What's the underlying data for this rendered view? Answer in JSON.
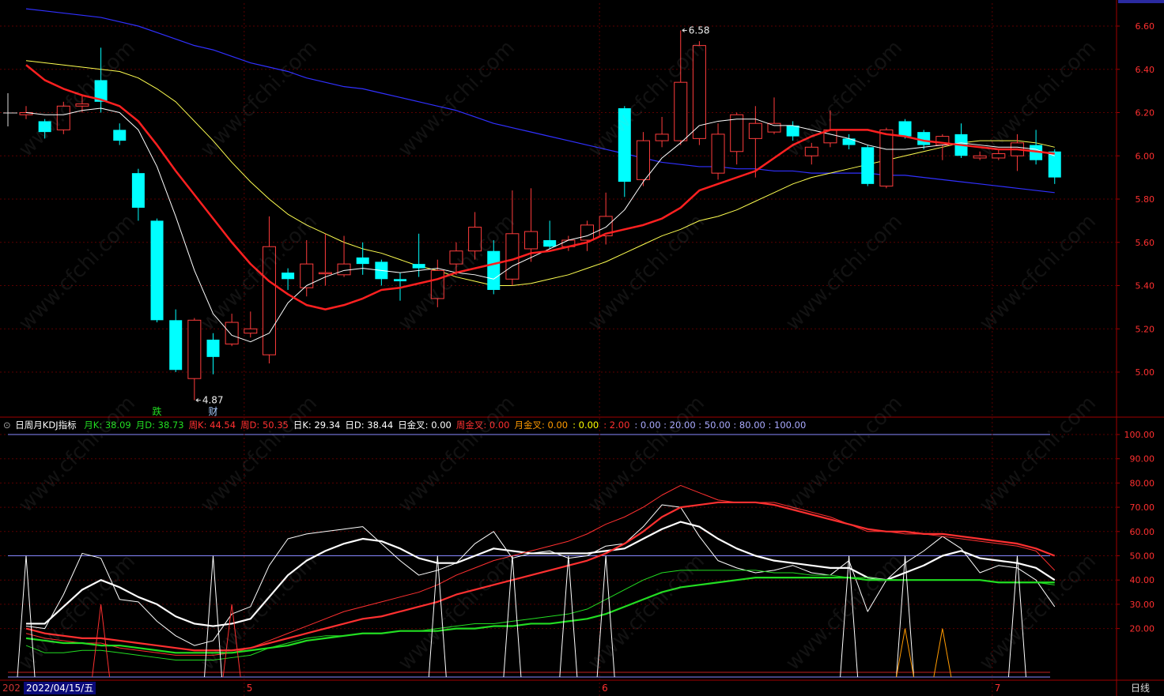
{
  "header": {
    "indicator_name": "日周月KDJ指标",
    "items": [
      {
        "text": "月K: 38.09",
        "color": "#22dd22"
      },
      {
        "text": "月D: 38.73",
        "color": "#22dd22"
      },
      {
        "text": "周K: 44.54",
        "color": "#ff3030"
      },
      {
        "text": "周D: 50.35",
        "color": "#ff3030"
      },
      {
        "text": "日K: 29.34",
        "color": "#ffffff"
      },
      {
        "text": "日D: 38.44",
        "color": "#ffffff"
      },
      {
        "text": "日金叉: 0.00",
        "color": "#ffffff"
      },
      {
        "text": "周金叉: 0.00",
        "color": "#ff3030"
      },
      {
        "text": "月金叉: 0.00",
        "color": "#ff9a00"
      },
      {
        "text": ": 0.00",
        "color": "#ffff00"
      },
      {
        "text": ": 2.00",
        "color": "#ff3030"
      },
      {
        "text": ": 0.00 : 20.00 : 50.00 : 80.00 : 100.00",
        "color": "#aaaaff"
      }
    ]
  },
  "status": {
    "date_prefix": "202",
    "date": "2022/04/15/五",
    "period_tab": "日线"
  },
  "watermark": "www.cfchi.com",
  "colors": {
    "up": "#ff3c3c",
    "down": "#00ffff",
    "ma_fast": "#ffffff",
    "ma_red": "#ff2020",
    "ma_yellow": "#ffff50",
    "ma_blue": "#3030ff",
    "grid": "#5a0000"
  },
  "chart_data": [
    {
      "type": "candlestick",
      "title": "",
      "y_ticks": [
        5.0,
        5.2,
        5.4,
        5.6,
        5.8,
        6.0,
        6.2,
        6.4,
        6.6
      ],
      "ylim": [
        4.8,
        6.7
      ],
      "x_labels": [
        "5",
        "6",
        "7"
      ],
      "x_label_index": [
        12,
        31,
        52
      ],
      "annotations": [
        {
          "text": "4.87",
          "index": 9,
          "value": 4.87
        },
        {
          "text": "6.58",
          "index": 35,
          "value": 6.58
        },
        {
          "text": "跌",
          "index": 7,
          "color": "#22dd22"
        },
        {
          "text": "财",
          "index": 10,
          "color": "#aaccff"
        }
      ],
      "candles": [
        [
          6.19,
          6.2,
          6.23,
          6.17
        ],
        [
          6.16,
          6.11,
          6.17,
          6.08
        ],
        [
          6.12,
          6.23,
          6.25,
          6.1
        ],
        [
          6.23,
          6.24,
          6.28,
          6.2
        ],
        [
          6.35,
          6.25,
          6.5,
          6.2
        ],
        [
          6.12,
          6.07,
          6.15,
          6.05
        ],
        [
          5.92,
          5.76,
          5.94,
          5.7
        ],
        [
          5.7,
          5.24,
          5.71,
          5.23
        ],
        [
          5.24,
          5.01,
          5.29,
          5.0
        ],
        [
          4.97,
          5.24,
          5.25,
          4.87
        ],
        [
          5.15,
          5.07,
          5.18,
          4.99
        ],
        [
          5.13,
          5.23,
          5.27,
          5.12
        ],
        [
          5.18,
          5.2,
          5.28,
          5.16
        ],
        [
          5.08,
          5.58,
          5.72,
          5.04
        ],
        [
          5.46,
          5.43,
          5.48,
          5.38
        ],
        [
          5.39,
          5.5,
          5.61,
          5.35
        ],
        [
          5.46,
          5.46,
          5.64,
          5.4
        ],
        [
          5.45,
          5.5,
          5.63,
          5.44
        ],
        [
          5.53,
          5.5,
          5.6,
          5.45
        ],
        [
          5.51,
          5.43,
          5.52,
          5.4
        ],
        [
          5.43,
          5.42,
          5.46,
          5.33
        ],
        [
          5.5,
          5.48,
          5.64,
          5.44
        ],
        [
          5.34,
          5.47,
          5.52,
          5.3
        ],
        [
          5.5,
          5.56,
          5.6,
          5.45
        ],
        [
          5.56,
          5.67,
          5.74,
          5.52
        ],
        [
          5.56,
          5.38,
          5.61,
          5.36
        ],
        [
          5.43,
          5.64,
          5.84,
          5.4
        ],
        [
          5.57,
          5.65,
          5.85,
          5.51
        ],
        [
          5.61,
          5.58,
          5.7,
          5.57
        ],
        [
          5.58,
          5.61,
          5.63,
          5.56
        ],
        [
          5.61,
          5.68,
          5.7,
          5.56
        ],
        [
          5.63,
          5.72,
          5.83,
          5.59
        ],
        [
          6.22,
          5.88,
          6.23,
          5.81
        ],
        [
          5.89,
          6.07,
          6.11,
          5.86
        ],
        [
          6.07,
          6.1,
          6.18,
          6.04
        ],
        [
          6.07,
          6.34,
          6.58,
          6.05
        ],
        [
          6.08,
          6.51,
          6.53,
          6.05
        ],
        [
          5.92,
          6.1,
          6.15,
          5.89
        ],
        [
          6.02,
          6.19,
          6.2,
          5.96
        ],
        [
          6.08,
          6.15,
          6.23,
          5.9
        ],
        [
          6.11,
          6.15,
          6.27,
          6.1
        ],
        [
          6.14,
          6.09,
          6.16,
          6.07
        ],
        [
          6.0,
          6.04,
          6.06,
          5.96
        ],
        [
          6.06,
          6.12,
          6.21,
          6.04
        ],
        [
          6.08,
          6.05,
          6.1,
          6.03
        ],
        [
          6.04,
          5.87,
          6.05,
          5.86
        ],
        [
          5.86,
          6.12,
          6.13,
          5.85
        ],
        [
          6.16,
          6.09,
          6.17,
          6.08
        ],
        [
          6.11,
          6.05,
          6.12,
          6.03
        ],
        [
          6.05,
          6.09,
          6.1,
          5.98
        ],
        [
          6.1,
          6.0,
          6.15,
          5.99
        ],
        [
          5.99,
          6.0,
          6.02,
          5.98
        ],
        [
          5.99,
          6.01,
          6.03,
          5.98
        ],
        [
          6.0,
          6.06,
          6.1,
          5.93
        ],
        [
          6.05,
          5.98,
          6.12,
          5.96
        ],
        [
          6.02,
          5.9,
          6.03,
          5.87
        ]
      ],
      "ma_white": [
        6.2,
        6.19,
        6.19,
        6.21,
        6.22,
        6.2,
        6.12,
        5.95,
        5.72,
        5.47,
        5.27,
        5.17,
        5.14,
        5.18,
        5.32,
        5.4,
        5.44,
        5.47,
        5.48,
        5.47,
        5.46,
        5.47,
        5.48,
        5.46,
        5.45,
        5.43,
        5.49,
        5.53,
        5.57,
        5.61,
        5.63,
        5.67,
        5.75,
        5.88,
        5.99,
        6.06,
        6.14,
        6.16,
        6.17,
        6.17,
        6.14,
        6.14,
        6.12,
        6.1,
        6.08,
        6.05,
        6.03,
        6.03,
        6.04,
        6.05,
        6.06,
        6.05,
        6.04,
        6.04,
        6.03,
        6.0
      ],
      "ma_red": [
        6.42,
        6.35,
        6.31,
        6.28,
        6.26,
        6.23,
        6.16,
        6.05,
        5.93,
        5.82,
        5.71,
        5.6,
        5.5,
        5.42,
        5.36,
        5.31,
        5.29,
        5.31,
        5.34,
        5.38,
        5.39,
        5.41,
        5.43,
        5.46,
        5.48,
        5.5,
        5.52,
        5.55,
        5.56,
        5.58,
        5.6,
        5.64,
        5.66,
        5.68,
        5.71,
        5.76,
        5.84,
        5.87,
        5.9,
        5.93,
        5.99,
        6.05,
        6.09,
        6.12,
        6.12,
        6.12,
        6.1,
        6.09,
        6.07,
        6.06,
        6.05,
        6.04,
        6.03,
        6.03,
        6.02,
        6.01
      ],
      "ma_yellow": [
        6.44,
        6.43,
        6.42,
        6.41,
        6.4,
        6.39,
        6.36,
        6.31,
        6.25,
        6.16,
        6.07,
        5.97,
        5.88,
        5.8,
        5.73,
        5.68,
        5.64,
        5.6,
        5.57,
        5.55,
        5.52,
        5.49,
        5.47,
        5.44,
        5.42,
        5.4,
        5.4,
        5.41,
        5.43,
        5.45,
        5.48,
        5.51,
        5.55,
        5.59,
        5.63,
        5.66,
        5.7,
        5.72,
        5.75,
        5.79,
        5.83,
        5.87,
        5.9,
        5.92,
        5.94,
        5.96,
        5.98,
        6.0,
        6.02,
        6.04,
        6.06,
        6.07,
        6.07,
        6.07,
        6.06,
        6.04
      ],
      "ma_blue": [
        6.68,
        6.67,
        6.66,
        6.65,
        6.64,
        6.62,
        6.6,
        6.57,
        6.54,
        6.51,
        6.49,
        6.46,
        6.43,
        6.41,
        6.39,
        6.36,
        6.34,
        6.32,
        6.31,
        6.29,
        6.27,
        6.25,
        6.23,
        6.21,
        6.18,
        6.15,
        6.13,
        6.11,
        6.09,
        6.07,
        6.05,
        6.03,
        6.01,
        5.99,
        5.97,
        5.96,
        5.95,
        5.95,
        5.94,
        5.94,
        5.93,
        5.93,
        5.92,
        5.92,
        5.92,
        5.92,
        5.91,
        5.91,
        5.9,
        5.89,
        5.88,
        5.87,
        5.86,
        5.85,
        5.84,
        5.83
      ]
    },
    {
      "type": "line",
      "title": "日周月KDJ指标",
      "y_ticks": [
        20,
        30,
        40,
        50,
        60,
        70,
        80,
        90,
        100
      ],
      "ylim": [
        0,
        105
      ],
      "reference_lines": [
        0,
        50,
        100
      ],
      "series": [
        {
          "name": "日K",
          "color": "#ffffff",
          "width": 1,
          "values": [
            21,
            20,
            34,
            51,
            49,
            32,
            31,
            23,
            17,
            13,
            15,
            26,
            29,
            46,
            57,
            59,
            60,
            61,
            62,
            55,
            48,
            42,
            44,
            47,
            55,
            60,
            49,
            51,
            52,
            49,
            50,
            54,
            55,
            62,
            71,
            70,
            58,
            48,
            45,
            43,
            44,
            46,
            43,
            42,
            48,
            27,
            40,
            47,
            52,
            58,
            53,
            43,
            46,
            45,
            40,
            29
          ]
        },
        {
          "name": "日D",
          "color": "#ffffff",
          "width": 2.2,
          "values": [
            22,
            22,
            29,
            36,
            40,
            37,
            33,
            30,
            25,
            22,
            21,
            22,
            24,
            33,
            42,
            48,
            52,
            55,
            57,
            56,
            53,
            49,
            47,
            47,
            50,
            53,
            52,
            51,
            51,
            51,
            51,
            52,
            53,
            57,
            61,
            64,
            62,
            57,
            53,
            50,
            48,
            47,
            46,
            45,
            45,
            41,
            40,
            43,
            46,
            50,
            52,
            49,
            48,
            47,
            45,
            40
          ]
        },
        {
          "name": "周K",
          "color": "#ff3030",
          "width": 1,
          "values": [
            18,
            16,
            15,
            14,
            14,
            12,
            11,
            10,
            9,
            9,
            9,
            10,
            12,
            15,
            18,
            21,
            24,
            27,
            29,
            31,
            33,
            35,
            38,
            42,
            45,
            48,
            50,
            52,
            54,
            56,
            59,
            63,
            66,
            70,
            75,
            79,
            76,
            73,
            72,
            72,
            72,
            70,
            68,
            66,
            63,
            60,
            60,
            59,
            59,
            58,
            57,
            56,
            55,
            54,
            52,
            44
          ]
        },
        {
          "name": "周D",
          "color": "#ff3030",
          "width": 2.2,
          "values": [
            20,
            18,
            17,
            16,
            16,
            15,
            14,
            13,
            12,
            11,
            11,
            11,
            12,
            14,
            16,
            18,
            20,
            22,
            24,
            25,
            27,
            29,
            31,
            34,
            36,
            38,
            40,
            42,
            44,
            46,
            48,
            51,
            55,
            60,
            66,
            70,
            71,
            72,
            72,
            72,
            71,
            69,
            67,
            65,
            63,
            61,
            60,
            60,
            59,
            59,
            58,
            57,
            56,
            55,
            53,
            50
          ]
        },
        {
          "name": "月K",
          "color": "#22dd22",
          "width": 1,
          "values": [
            13,
            10,
            10,
            11,
            11,
            10,
            9,
            8,
            7,
            7,
            7,
            8,
            9,
            12,
            14,
            16,
            17,
            17,
            18,
            18,
            19,
            19,
            20,
            21,
            22,
            22,
            23,
            24,
            25,
            26,
            28,
            32,
            36,
            40,
            43,
            44,
            44,
            44,
            44,
            44,
            43,
            43,
            42,
            42,
            41,
            41,
            40,
            40,
            40,
            40,
            40,
            40,
            39,
            39,
            39,
            38
          ]
        },
        {
          "name": "月D",
          "color": "#22dd22",
          "width": 2.2,
          "values": [
            16,
            15,
            14,
            14,
            13,
            13,
            12,
            11,
            10,
            10,
            10,
            10,
            11,
            12,
            13,
            15,
            16,
            17,
            18,
            18,
            19,
            19,
            19,
            20,
            20,
            21,
            21,
            22,
            22,
            23,
            24,
            26,
            29,
            32,
            35,
            37,
            38,
            39,
            40,
            41,
            41,
            41,
            41,
            41,
            41,
            40,
            40,
            40,
            40,
            40,
            40,
            40,
            39,
            39,
            39,
            39
          ]
        },
        {
          "name": "日金叉",
          "color": "#ffffff",
          "width": 1,
          "spikes": [
            0,
            10,
            22,
            26,
            29,
            31,
            44,
            47,
            53
          ],
          "base": 0,
          "top": 50
        },
        {
          "name": "周金叉",
          "color": "#ff3030",
          "width": 1,
          "spikes": [
            4,
            11
          ],
          "base": 0,
          "top": 30
        },
        {
          "name": "月金叉",
          "color": "#ff9a00",
          "width": 1,
          "spikes": [
            47,
            49
          ],
          "base": 0,
          "top": 20
        }
      ]
    }
  ]
}
